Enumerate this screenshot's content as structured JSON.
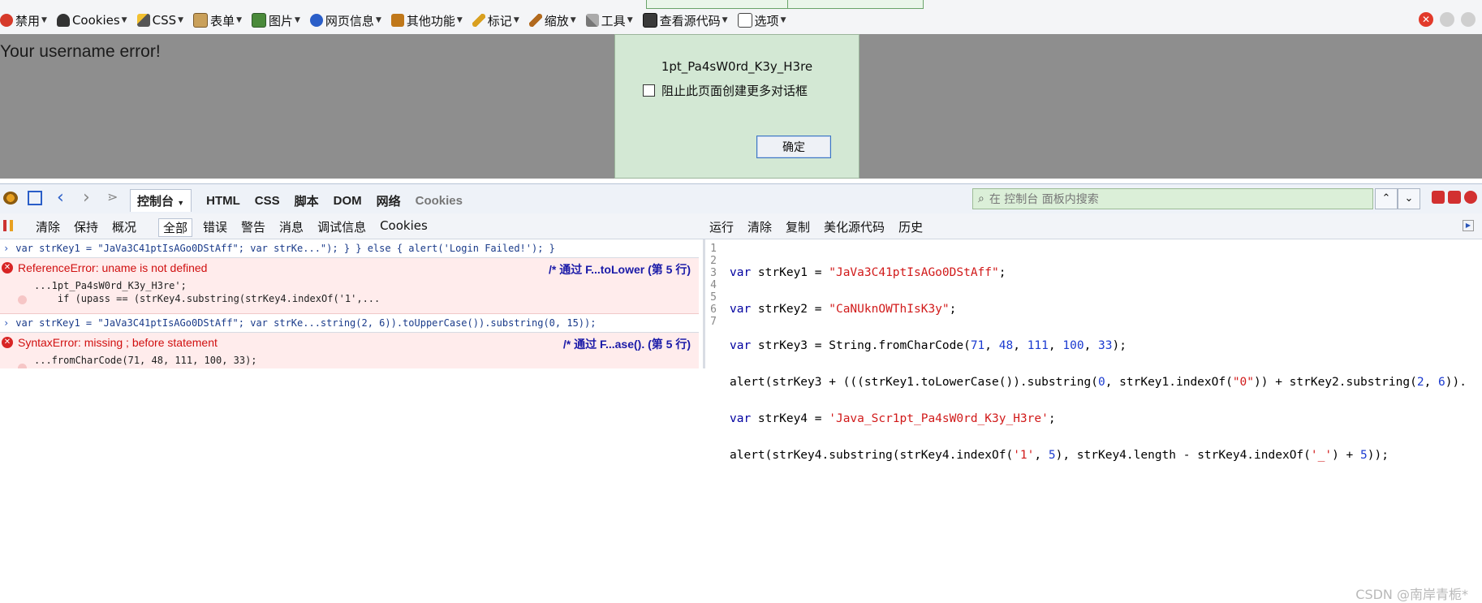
{
  "toolbar": {
    "items": [
      "禁用",
      "Cookies",
      "CSS",
      "表单",
      "图片",
      "网页信息",
      "其他功能",
      "标记",
      "缩放",
      "工具",
      "查看源代码",
      "选项"
    ]
  },
  "page": {
    "text": "Your username error!"
  },
  "dialog": {
    "message": "1pt_Pa4sW0rd_K3y_H3re",
    "checkbox_label": "阻止此页面创建更多对话框",
    "ok_label": "确定"
  },
  "firebug": {
    "tabs": [
      "控制台",
      "HTML",
      "CSS",
      "脚本",
      "DOM",
      "网络",
      "Cookies"
    ],
    "search_placeholder": "在 控制台 面板内搜索",
    "console_buttons": [
      "清除",
      "保持",
      "概况"
    ],
    "filters": [
      "全部",
      "错误",
      "警告",
      "消息",
      "调试信息",
      "Cookies"
    ],
    "editor_buttons": [
      "运行",
      "清除",
      "复制",
      "美化源代码",
      "历史"
    ]
  },
  "console": {
    "cmd1": "var strKey1 = \"JaVa3C41ptIsAGo0DStAff\"; var strKe...\");     } } else {      alert('Login Failed!'); }",
    "err1": {
      "title": "ReferenceError: uname is not defined",
      "location": "/* 通过 F...toLower (第 5 行)",
      "line1": "...1pt_Pa4sW0rd_K3y_H3re';",
      "line2": "    if (upass == (strKey4.substring(strKey4.indexOf('1',..."
    },
    "cmd2": "var strKey1 = \"JaVa3C41ptIsAGo0DStAff\"; var strKe...string(2, 6)).toUpperCase()).substring(0, 15));",
    "err2": {
      "title": "SyntaxError: missing ; before statement",
      "location": "/* 通过 F...ase(). (第 5 行)",
      "line1": "...fromCharCode(71, 48, 111, 100, 33);"
    }
  },
  "editor": {
    "line_numbers": [
      "1",
      "2",
      "3",
      "4",
      "5",
      "6",
      "7"
    ],
    "lines": [
      "var strKey1 = \"JaVa3C41ptIsAGo0DStAff\";",
      "var strKey2 = \"CaNUknOWThIsK3y\";",
      "var strKey3 = String.fromCharCode(71, 48, 111, 100, 33);",
      "alert(strKey3 + (((strKey1.toLowerCase()).substring(0, strKey1.indexOf(\"0\")) + strKey2.substring(2, 6)).",
      "var strKey4 = 'Java_Scr1pt_Pa4sW0rd_K3y_H3re';",
      "alert(strKey4.substring(strKey4.indexOf('1', 5), strKey4.length - strKey4.indexOf('_') + 5));",
      ""
    ]
  },
  "watermark": "CSDN @南岸青栀*"
}
